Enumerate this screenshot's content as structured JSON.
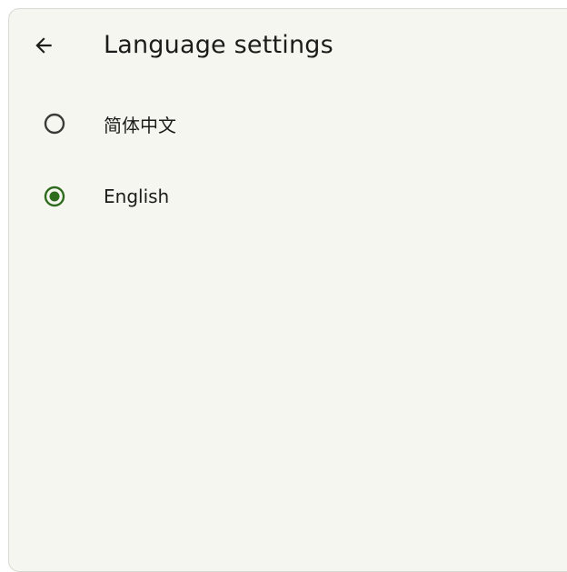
{
  "header": {
    "title": "Language settings",
    "back_icon": "arrow-left-icon"
  },
  "options": [
    {
      "label": "简体中文",
      "selected": false
    },
    {
      "label": "English",
      "selected": true
    }
  ],
  "colors": {
    "accent": "#2e6b1e",
    "background": "#f6f6f0",
    "text": "#1c1c1a",
    "radio_outline": "#3a3a38"
  }
}
